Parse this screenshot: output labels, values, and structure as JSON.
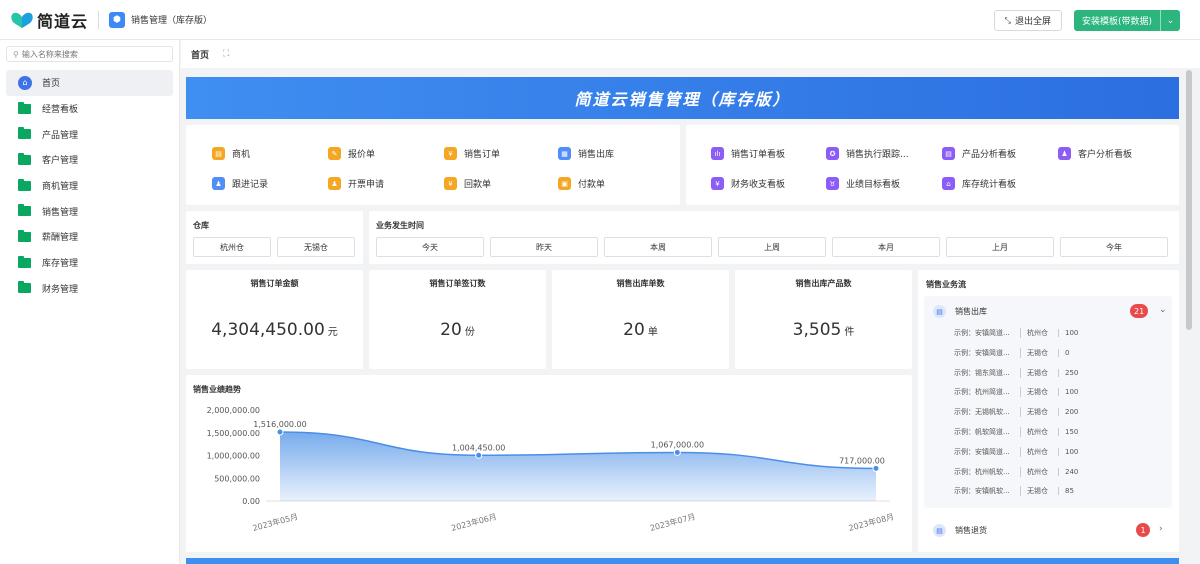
{
  "header": {
    "logo_text": "简道云",
    "app_name": "销售管理（库存版）",
    "exit_fullscreen": "退出全屏",
    "install_template": "安装模板(带数据)"
  },
  "sidebar": {
    "search_placeholder": "输入名称来搜索",
    "items": [
      {
        "label": "首页"
      },
      {
        "label": "经营看板"
      },
      {
        "label": "产品管理"
      },
      {
        "label": "客户管理"
      },
      {
        "label": "商机管理"
      },
      {
        "label": "销售管理"
      },
      {
        "label": "薪酬管理"
      },
      {
        "label": "库存管理"
      },
      {
        "label": "财务管理"
      }
    ]
  },
  "tabs": {
    "home": "首页",
    "expand_icon": "expand-icon"
  },
  "banner": {
    "title": "简道云销售管理（库存版）"
  },
  "quick_links_left": [
    {
      "label": "商机",
      "color": "#f5a623"
    },
    {
      "label": "报价单",
      "color": "#f5a623"
    },
    {
      "label": "销售订单",
      "color": "#f5a623"
    },
    {
      "label": "销售出库",
      "color": "#4f8ff7"
    },
    {
      "label": "跟进记录",
      "color": "#4f8ff7"
    },
    {
      "label": "开票申请",
      "color": "#f5a623"
    },
    {
      "label": "回款单",
      "color": "#f5a623"
    },
    {
      "label": "付款单",
      "color": "#f5a623"
    }
  ],
  "quick_links_right": [
    {
      "label": "销售订单看板",
      "color": "#8b5cf6"
    },
    {
      "label": "销售执行跟踪...",
      "color": "#8b5cf6"
    },
    {
      "label": "产品分析看板",
      "color": "#8b5cf6"
    },
    {
      "label": "客户分析看板",
      "color": "#8b5cf6"
    },
    {
      "label": "财务收支看板",
      "color": "#8b5cf6"
    },
    {
      "label": "业绩目标看板",
      "color": "#8b5cf6"
    },
    {
      "label": "库存统计看板",
      "color": "#8b5cf6"
    }
  ],
  "filters": {
    "warehouse_title": "仓库",
    "warehouses": [
      "杭州仓",
      "无锡仓"
    ],
    "time_title": "业务发生时间",
    "times": [
      "今天",
      "昨天",
      "本周",
      "上周",
      "本月",
      "上月",
      "今年"
    ]
  },
  "kpis": [
    {
      "title": "销售订单金额",
      "value": "4,304,450.00",
      "unit": "元"
    },
    {
      "title": "销售订单签订数",
      "value": "20",
      "unit": "份"
    },
    {
      "title": "销售出库单数",
      "value": "20",
      "unit": "单"
    },
    {
      "title": "销售出库产品数",
      "value": "3,505",
      "unit": "件"
    }
  ],
  "flow": {
    "title": "销售业务流",
    "group1": {
      "name": "销售出库",
      "badge": "21"
    },
    "rows": [
      [
        "示例：安镇简道...",
        "杭州仓",
        "100"
      ],
      [
        "示例：安镇简道...",
        "无锡仓",
        "0"
      ],
      [
        "示例：锡东简道...",
        "无锡仓",
        "250"
      ],
      [
        "示例：杭州简道...",
        "无锡仓",
        "100"
      ],
      [
        "示例：无锡帆软...",
        "无锡仓",
        "200"
      ],
      [
        "示例：帆软简道...",
        "杭州仓",
        "150"
      ],
      [
        "示例：安镇简道...",
        "杭州仓",
        "100"
      ],
      [
        "示例：杭州帆软...",
        "杭州仓",
        "240"
      ],
      [
        "示例：安镇帆软...",
        "无锡仓",
        "85"
      ]
    ],
    "group2": {
      "name": "销售退货",
      "badge": "1"
    }
  },
  "chart_data": {
    "type": "area",
    "title": "销售业绩趋势",
    "categories": [
      "2023年05月",
      "2023年06月",
      "2023年07月",
      "2023年08月"
    ],
    "values": [
      1516000,
      1004450,
      1067000,
      717000
    ],
    "value_labels": [
      "1,516,000.00",
      "1,004,450.00",
      "1,067,000.00",
      "717,000.00"
    ],
    "yticks": [
      "2,000,000.00",
      "1,500,000.00",
      "1,000,000.00",
      "500,000.00",
      "0.00"
    ],
    "ylim": [
      0,
      2000000
    ],
    "color": "#4a8fe7"
  }
}
